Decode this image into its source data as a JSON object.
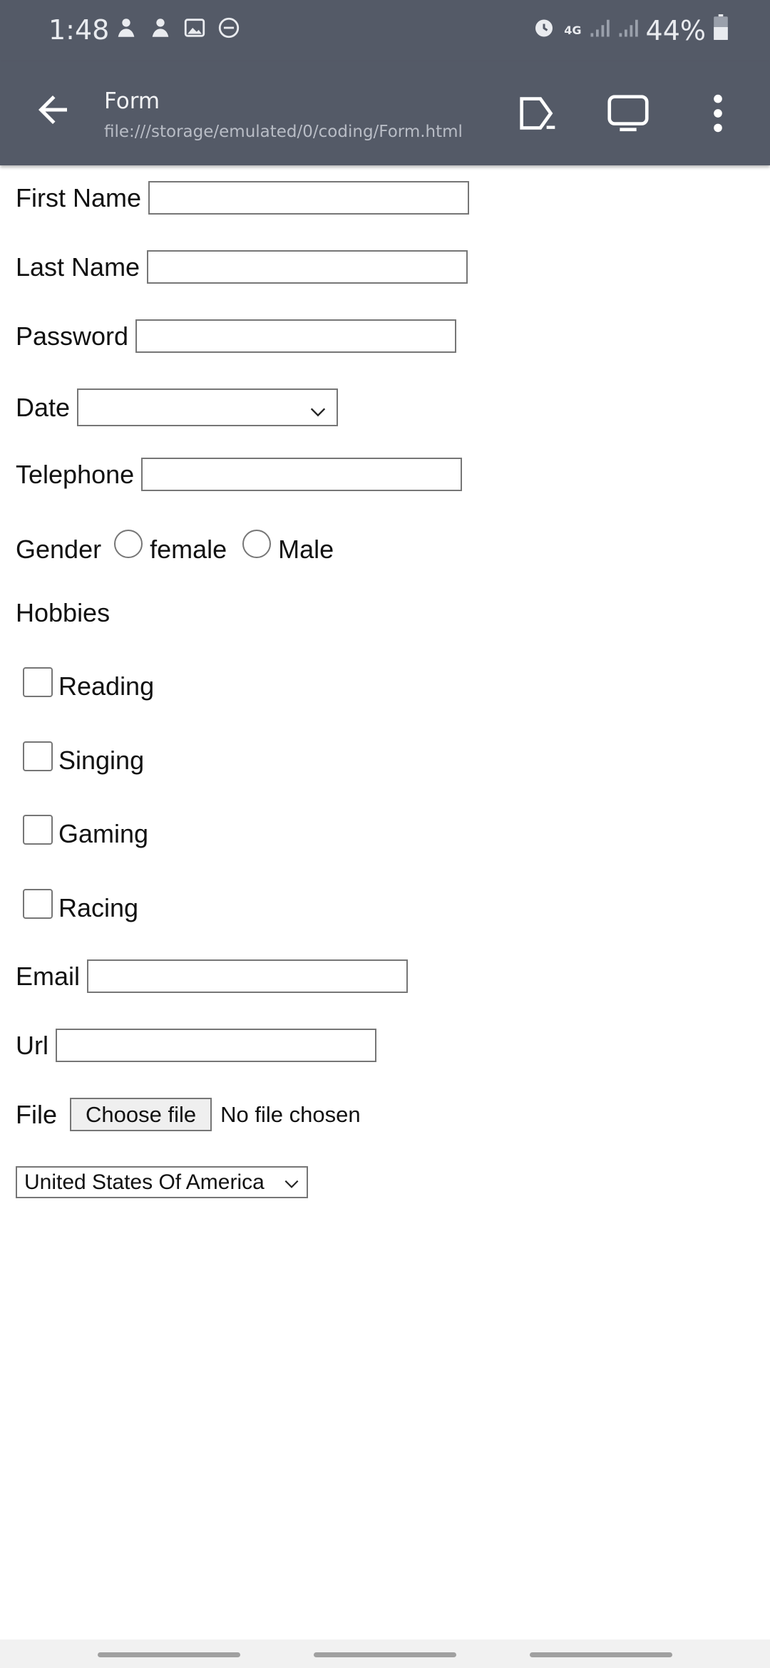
{
  "status_bar": {
    "time": "1:48",
    "network": "4G",
    "battery": "44%",
    "icons_left": [
      "notification-icon",
      "notification-icon",
      "image-icon",
      "do-not-disturb-icon"
    ],
    "icons_right": [
      "alarm-icon",
      "network-icon",
      "signal-icon",
      "signal-icon",
      "battery-icon"
    ]
  },
  "toolbar": {
    "title": "Form",
    "url": "file:///storage/emulated/0/coding/Form.html",
    "icons": [
      "back-arrow-icon",
      "run-icon",
      "desktop-view-icon",
      "more-vert-icon"
    ]
  },
  "form": {
    "first_name_label": "First Name",
    "last_name_label": "Last Name",
    "password_label": "Password",
    "date_label": "Date",
    "telephone_label": "Telephone",
    "gender_label": "Gender",
    "gender_options": [
      "female",
      "Male"
    ],
    "hobbies_label": "Hobbies",
    "hobbies": [
      "Reading",
      "Singing",
      "Gaming",
      "Racing"
    ],
    "email_label": "Email",
    "url_label": "Url",
    "file_label": "File",
    "file_button": "Choose file",
    "file_status": "No file chosen",
    "country_selected": "United States Of America"
  }
}
